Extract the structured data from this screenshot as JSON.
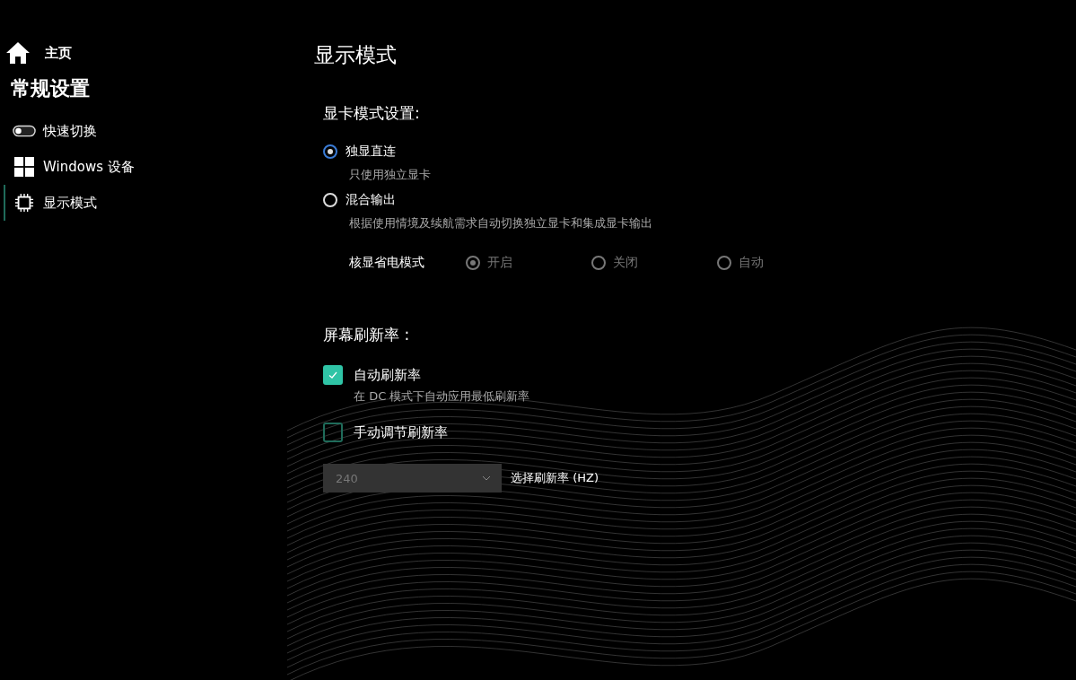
{
  "sidebar": {
    "home": {
      "label": "主页"
    },
    "section_title": "常规设置",
    "items": [
      {
        "label": "快速切换",
        "kind": "toggle",
        "selected": false
      },
      {
        "label": "Windows 设备",
        "kind": "windows",
        "selected": false
      },
      {
        "label": "显示模式",
        "kind": "chip",
        "selected": true
      }
    ]
  },
  "page_title": "显示模式",
  "gpu_mode": {
    "heading": "显卡模式设置:",
    "options": [
      {
        "label": "独显直连",
        "description": "只使用独立显卡",
        "selected": true
      },
      {
        "label": "混合输出",
        "description": "根据使用情境及续航需求自动切换独立显卡和集成显卡输出",
        "selected": false
      }
    ],
    "power_saving": {
      "label": "核显省电模式",
      "disabled": true,
      "options": [
        {
          "label": "开启",
          "selected": true
        },
        {
          "label": "关闭",
          "selected": false
        },
        {
          "label": "自动",
          "selected": false
        }
      ]
    }
  },
  "refresh_rate": {
    "heading": "屏幕刷新率 :",
    "options": [
      {
        "label": "自动刷新率",
        "description": "在 DC 模式下自动应用最低刷新率",
        "checked": true
      },
      {
        "label": "手动调节刷新率",
        "checked": false
      }
    ],
    "select": {
      "value": "240",
      "label": "选择刷新率 (HZ)",
      "disabled": true
    }
  }
}
